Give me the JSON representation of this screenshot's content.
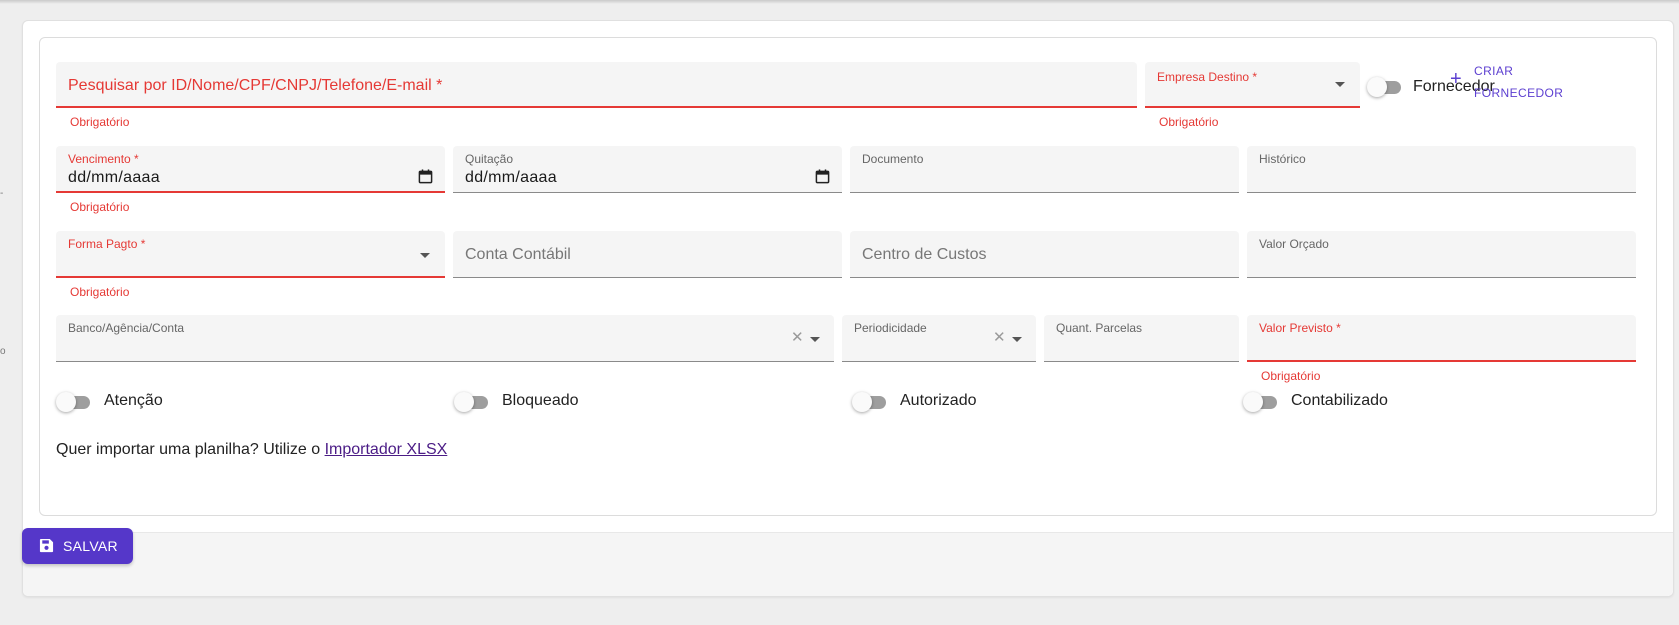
{
  "form": {
    "search": {
      "label": "Pesquisar por ID/Nome/CPF/CNPJ/Telefone/E-mail *",
      "helper": "Obrigatório"
    },
    "empresa_destino": {
      "label": "Empresa Destino *",
      "helper": "Obrigatório"
    },
    "fornecedor_toggle": {
      "label": "Fornecedor",
      "on": false
    },
    "criar_fornecedor": {
      "line1": "Criar",
      "line2": "Fornecedor",
      "icon": "plus-icon"
    },
    "vencimento": {
      "label": "Vencimento *",
      "value": "dd/mm/aaaa",
      "helper": "Obrigatório"
    },
    "quitacao": {
      "label": "Quitação",
      "value": "dd/mm/aaaa"
    },
    "documento": {
      "label": "Documento"
    },
    "historico": {
      "label": "Histórico"
    },
    "forma_pagto": {
      "label": "Forma Pagto *",
      "helper": "Obrigatório"
    },
    "conta_contabil": {
      "placeholder": "Conta Contábil"
    },
    "centro_custos": {
      "placeholder": "Centro de Custos"
    },
    "valor_orcado": {
      "label": "Valor Orçado"
    },
    "banco": {
      "label": "Banco/Agência/Conta"
    },
    "periodicidade": {
      "label": "Periodicidade"
    },
    "quant_parcelas": {
      "label": "Quant. Parcelas"
    },
    "valor_previsto": {
      "label": "Valor Previsto *",
      "helper": "Obrigatório"
    },
    "toggles": [
      {
        "label": "Atenção",
        "on": false
      },
      {
        "label": "Bloqueado",
        "on": false
      },
      {
        "label": "Autorizado",
        "on": false
      },
      {
        "label": "Contabilizado",
        "on": false
      }
    ],
    "import": {
      "text": "Quer importar uma planilha? Utilize o",
      "link": "Importador XLSX"
    }
  },
  "footer": {
    "save_label": "Salvar",
    "save_icon": "floppy-disk-icon"
  },
  "edge_marks": {
    "mark1": "-",
    "mark2": "o"
  },
  "colors": {
    "error": "#e53935",
    "accent": "#5537c9",
    "link": "#4b1c86",
    "field_bg": "#f5f5f5"
  }
}
